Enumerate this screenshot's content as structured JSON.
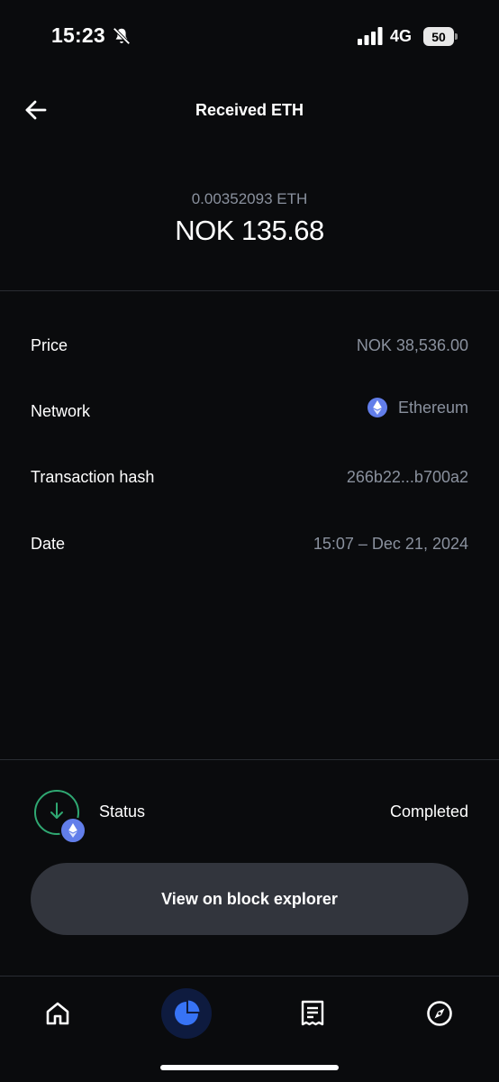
{
  "status_bar": {
    "time": "15:23",
    "network": "4G",
    "battery": "50"
  },
  "header": {
    "title": "Received ETH"
  },
  "amount": {
    "crypto": "0.00352093 ETH",
    "fiat": "NOK 135.68"
  },
  "details": {
    "price_label": "Price",
    "price_value": "NOK 38,536.00",
    "network_label": "Network",
    "network_value": "Ethereum",
    "hash_label": "Transaction hash",
    "hash_value": "266b22...b700a2",
    "date_label": "Date",
    "date_value": "15:07 – Dec 21, 2024"
  },
  "status": {
    "label": "Status",
    "value": "Completed"
  },
  "actions": {
    "explorer_label": "View on block explorer"
  },
  "icons": {
    "back": "arrow-left-icon",
    "home": "home-icon",
    "portfolio": "pie-chart-icon",
    "activity": "receipt-icon",
    "explore": "compass-icon",
    "eth": "ethereum-icon",
    "status": "arrow-down-icon"
  },
  "colors": {
    "background": "#0a0b0d",
    "muted_text": "#8a919e",
    "accent": "#3773f5",
    "success": "#2fa872",
    "eth": "#627eea",
    "button": "#32353d"
  }
}
